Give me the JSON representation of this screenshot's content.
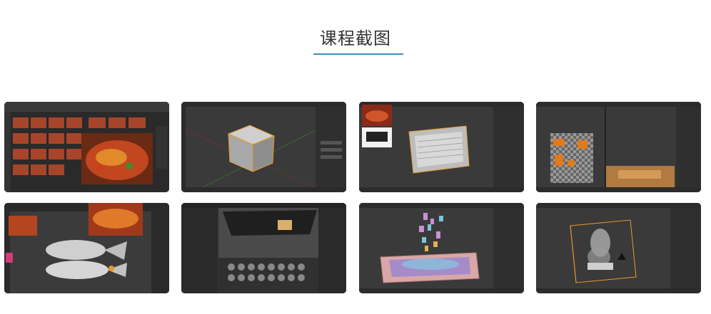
{
  "section": {
    "title": "课程截图"
  },
  "screenshots": [
    {
      "name": "screenshot-food-photo-gallery"
    },
    {
      "name": "screenshot-blender-default-cube"
    },
    {
      "name": "screenshot-blender-tray-model"
    },
    {
      "name": "screenshot-blender-uv-texture"
    },
    {
      "name": "screenshot-zbrush-fish-sculpt"
    },
    {
      "name": "screenshot-blender-material-browser"
    },
    {
      "name": "screenshot-blender-food-particles"
    },
    {
      "name": "screenshot-blender-smoke-volume"
    }
  ]
}
